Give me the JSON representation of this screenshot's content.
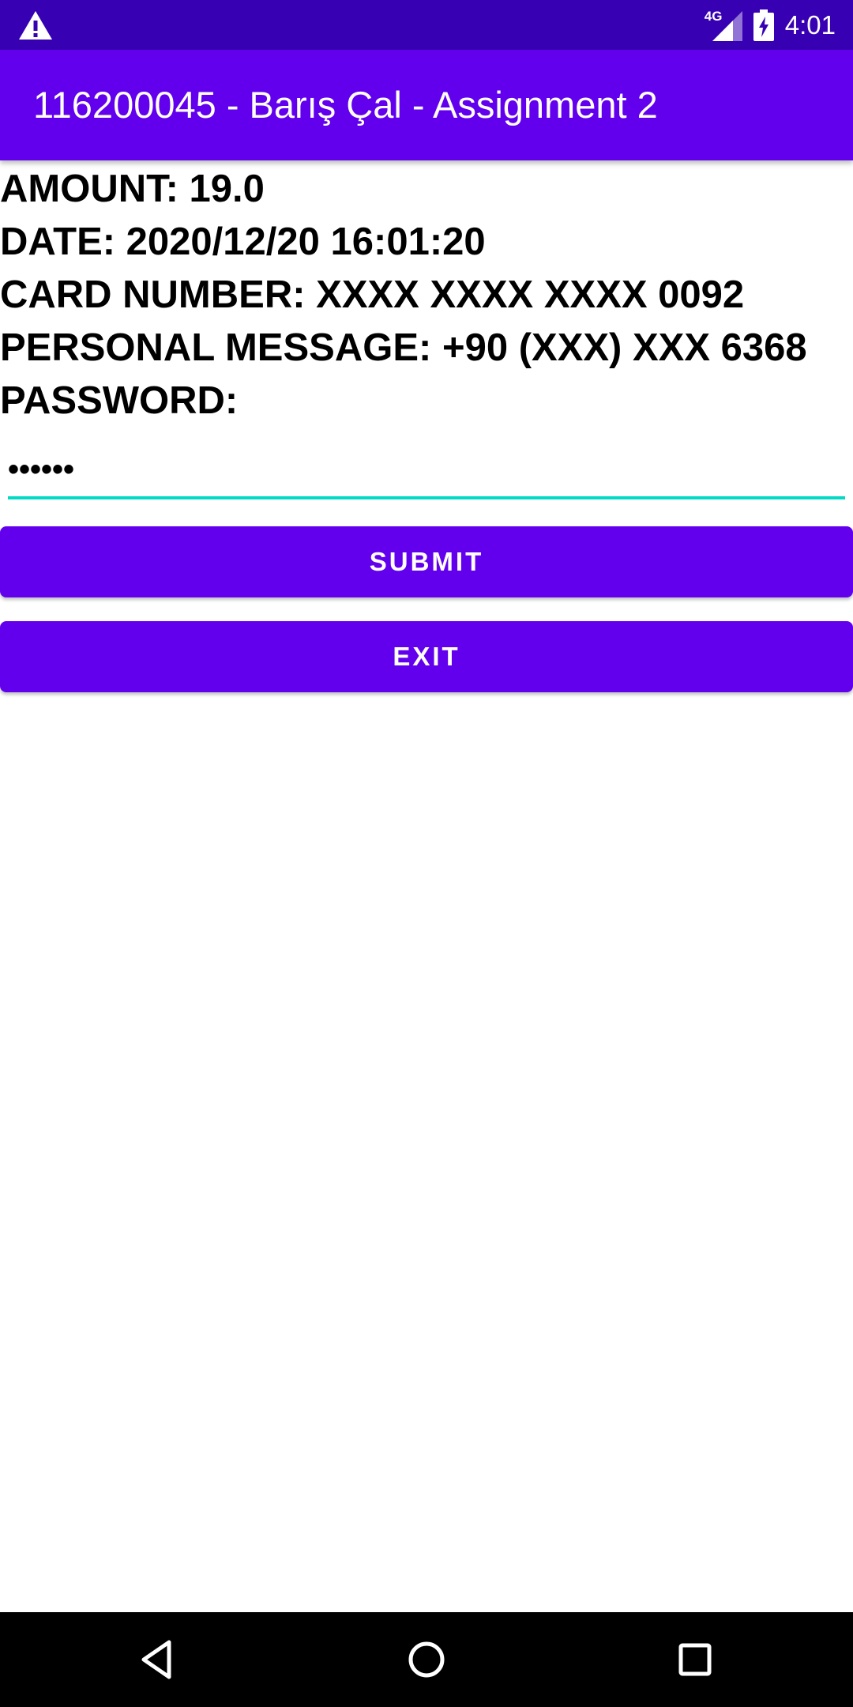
{
  "status_bar": {
    "network": "4G",
    "time": "4:01",
    "icons": [
      "warning-icon",
      "signal-icon",
      "battery-charging-icon"
    ]
  },
  "app_bar": {
    "title": "116200045 - Barış Çal - Assignment 2"
  },
  "info": {
    "amount": "AMOUNT: 19.0",
    "date": "DATE: 2020/12/20 16:01:20",
    "card_number": "CARD NUMBER: XXXX XXXX XXXX 0092",
    "personal_message": "PERSONAL MESSAGE: +90 (XXX) XXX 6368",
    "password_label": "PASSWORD:"
  },
  "password_field": {
    "value": "••••••"
  },
  "buttons": {
    "submit": "SUBMIT",
    "exit": "EXIT"
  },
  "nav_bar": {
    "icons": [
      "back-icon",
      "home-icon",
      "recents-icon"
    ]
  },
  "colors": {
    "status_bar": "#3700b3",
    "primary": "#6200ee",
    "accent": "#03dac5"
  }
}
